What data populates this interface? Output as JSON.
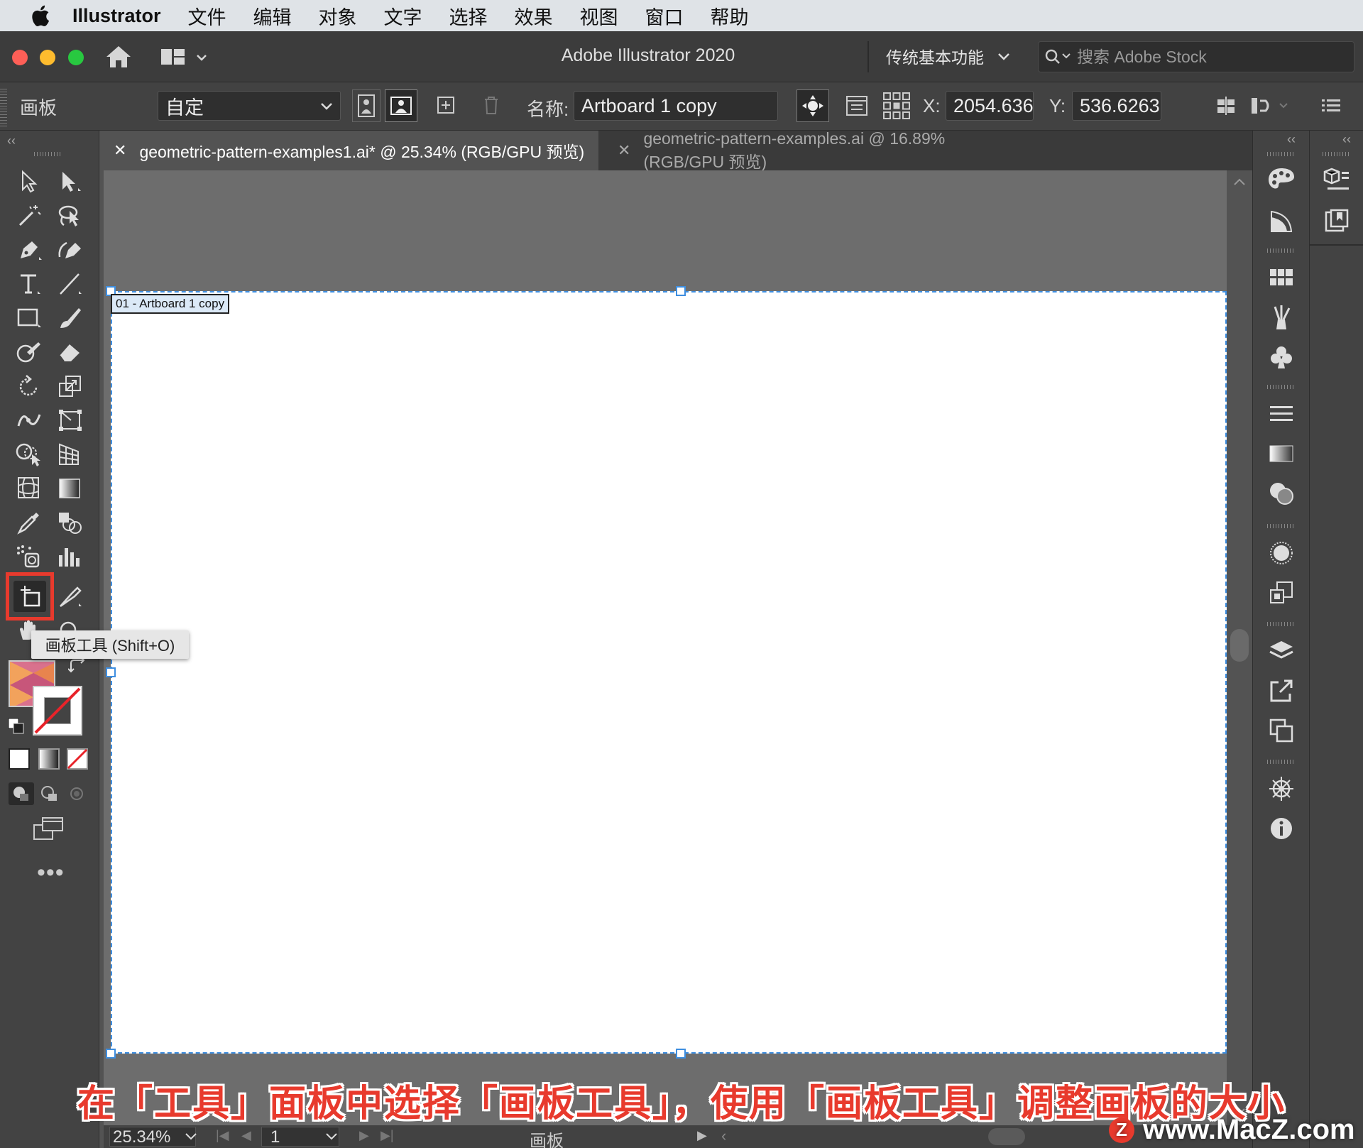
{
  "menubar": {
    "app": "Illustrator",
    "items": [
      "文件",
      "编辑",
      "对象",
      "文字",
      "选择",
      "效果",
      "视图",
      "窗口",
      "帮助"
    ]
  },
  "titlebar": {
    "title": "Adobe Illustrator 2020",
    "workspace": "传统基本功能",
    "stock_placeholder": "搜索 Adobe Stock"
  },
  "controlbar": {
    "panel_label": "画板",
    "preset": "自定",
    "name_label": "名称:",
    "name_value": "Artboard 1 copy",
    "x_label": "X:",
    "x_value": "2054.636",
    "y_label": "Y:",
    "y_value": "536.6263"
  },
  "tabs": [
    {
      "label": "geometric-pattern-examples1.ai* @ 25.34% (RGB/GPU 预览)",
      "active": true
    },
    {
      "label": "geometric-pattern-examples.ai @ 16.89% (RGB/GPU 预览)",
      "active": false
    }
  ],
  "artboard": {
    "label": "01 - Artboard 1 copy"
  },
  "tooltip": "画板工具 (Shift+O)",
  "statusbar": {
    "zoom": "25.34%",
    "page": "1",
    "tool_name": "画板"
  },
  "subtitle": "在「工具」面板中选择「画板工具」，使用「画板工具」调整画板的大小",
  "watermark": "www.MacZ.com",
  "colors": {
    "accent_red": "#e83a2d",
    "selection_blue": "#3e8ee0"
  }
}
